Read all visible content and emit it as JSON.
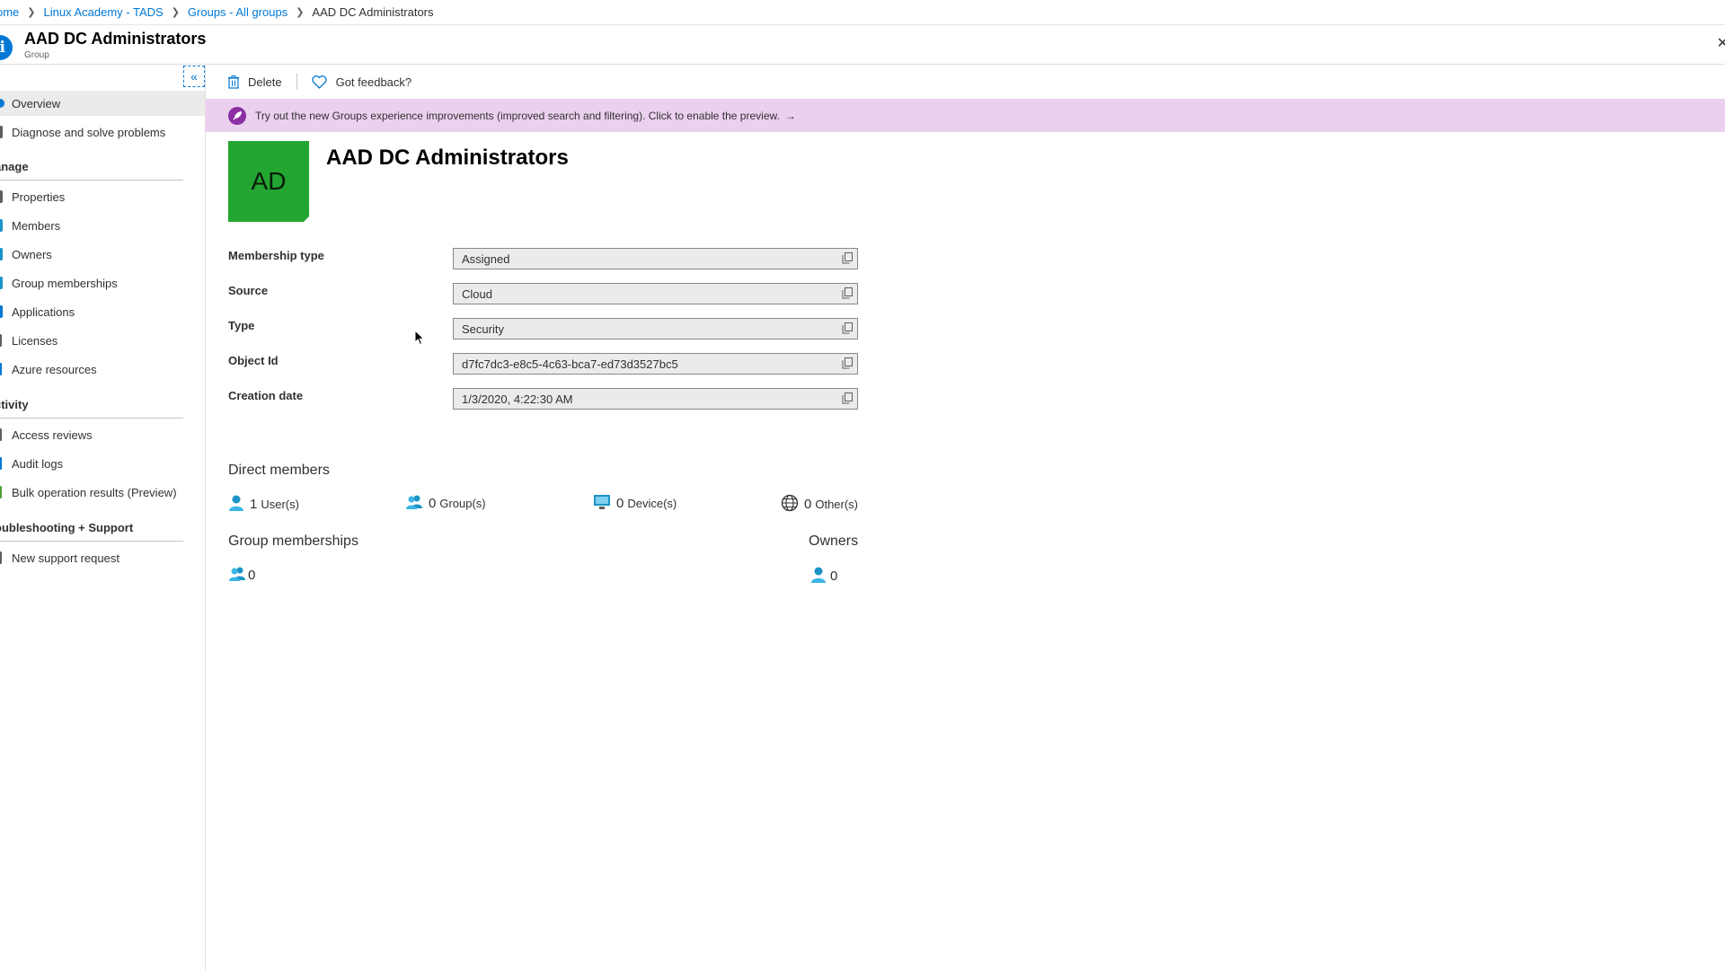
{
  "breadcrumb": {
    "items": [
      "ome",
      "Linux Academy - TADS",
      "Groups - All groups"
    ],
    "current": "AAD DC Administrators"
  },
  "header": {
    "title": "AAD DC Administrators",
    "subtitle": "Group",
    "icon": "info-icon",
    "close_icon": "close-icon"
  },
  "sidebar": {
    "collapse_icon": "double-chevron-left-icon",
    "items_top": [
      {
        "label": "Overview",
        "icon": "info-icon",
        "active": true
      },
      {
        "label": "Diagnose and solve problems",
        "icon": "wrench-icon",
        "active": false
      }
    ],
    "section_manage": "anage",
    "items_manage": [
      {
        "label": "Properties",
        "icon": "properties-icon"
      },
      {
        "label": "Members",
        "icon": "members-icon"
      },
      {
        "label": "Owners",
        "icon": "owners-icon"
      },
      {
        "label": "Group memberships",
        "icon": "group-memberships-icon"
      },
      {
        "label": "Applications",
        "icon": "applications-icon"
      },
      {
        "label": "Licenses",
        "icon": "licenses-icon"
      },
      {
        "label": "Azure resources",
        "icon": "azure-resources-icon"
      }
    ],
    "section_activity": "ctivity",
    "items_activity": [
      {
        "label": "Access reviews",
        "icon": "access-reviews-icon"
      },
      {
        "label": "Audit logs",
        "icon": "audit-logs-icon"
      },
      {
        "label": "Bulk operation results (Preview)",
        "icon": "bulk-operations-icon"
      }
    ],
    "section_support": "oubleshooting + Support",
    "items_support": [
      {
        "label": "New support request",
        "icon": "support-icon"
      }
    ]
  },
  "toolbar": {
    "delete_label": "Delete",
    "feedback_label": "Got feedback?"
  },
  "banner": {
    "text": "Try out the new Groups experience improvements (improved search and filtering). Click to enable the preview.",
    "arrow": "→",
    "color": "#ebd0f0"
  },
  "group": {
    "initials": "AD",
    "name": "AAD DC Administrators",
    "avatar_color": "#22a531"
  },
  "properties": [
    {
      "label": "Membership type",
      "value": "Assigned"
    },
    {
      "label": "Source",
      "value": "Cloud"
    },
    {
      "label": "Type",
      "value": "Security"
    },
    {
      "label": "Object Id",
      "value": "d7fc7dc3-e8c5-4c63-bca7-ed73d3527bc5"
    },
    {
      "label": "Creation date",
      "value": "1/3/2020, 4:22:30 AM"
    }
  ],
  "direct_members": {
    "title": "Direct members",
    "users": {
      "count": "1",
      "label": "User(s)"
    },
    "groups": {
      "count": "0",
      "label": "Group(s)"
    },
    "devices": {
      "count": "0",
      "label": "Device(s)"
    },
    "others": {
      "count": "0",
      "label": "Other(s)"
    }
  },
  "group_memberships": {
    "title": "Group memberships",
    "count": "0"
  },
  "owners": {
    "title": "Owners",
    "count": "0"
  }
}
